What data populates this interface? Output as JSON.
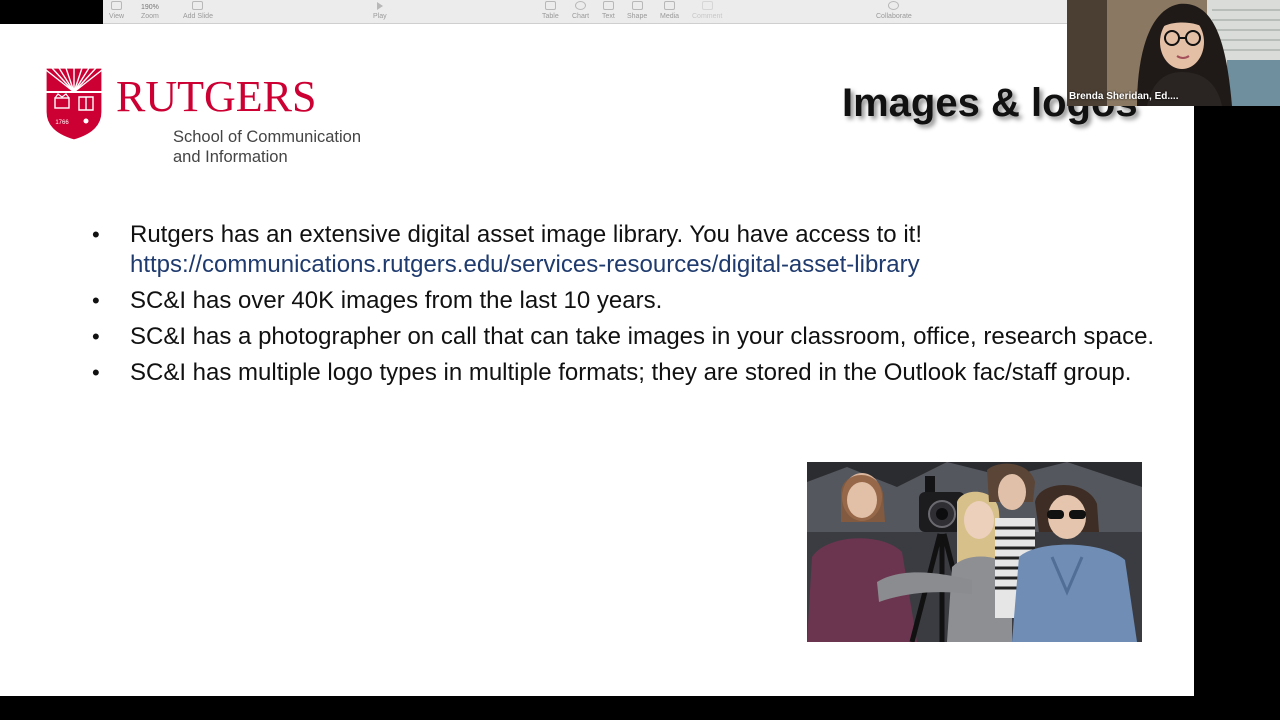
{
  "toolbar": {
    "zoom_value": "190%",
    "items": [
      {
        "label": "View"
      },
      {
        "label": "Zoom"
      },
      {
        "label": "Add Slide"
      },
      {
        "label": "Play"
      },
      {
        "label": "Table"
      },
      {
        "label": "Chart"
      },
      {
        "label": "Text"
      },
      {
        "label": "Shape"
      },
      {
        "label": "Media"
      },
      {
        "label": "Comment"
      },
      {
        "label": "Collaborate"
      }
    ]
  },
  "slide": {
    "logo": {
      "wordmark": "RUTGERS",
      "school_line1": "School of Communication",
      "school_line2": "and Information",
      "shield_year": "1766",
      "brand_color": "#cc0033"
    },
    "title": "Images & logos",
    "bullets": [
      {
        "text": "Rutgers has an extensive digital asset image library. You have access to it! ",
        "link": "https://communications.rutgers.edu/services-resources/digital-asset-library"
      },
      {
        "text": "SC&I has over 40K images from the last 10 years."
      },
      {
        "text": "SC&I has a photographer on call that can take images in your classroom, office, research space."
      },
      {
        "text": "SC&I has multiple logo types in multiple formats; they are stored in the Outlook fac/staff group."
      }
    ]
  },
  "video": {
    "participant_name": "Brenda Sheridan, Ed...."
  },
  "colors": {
    "link": "#1f3b6e",
    "toolbar_bg": "#ececec"
  }
}
